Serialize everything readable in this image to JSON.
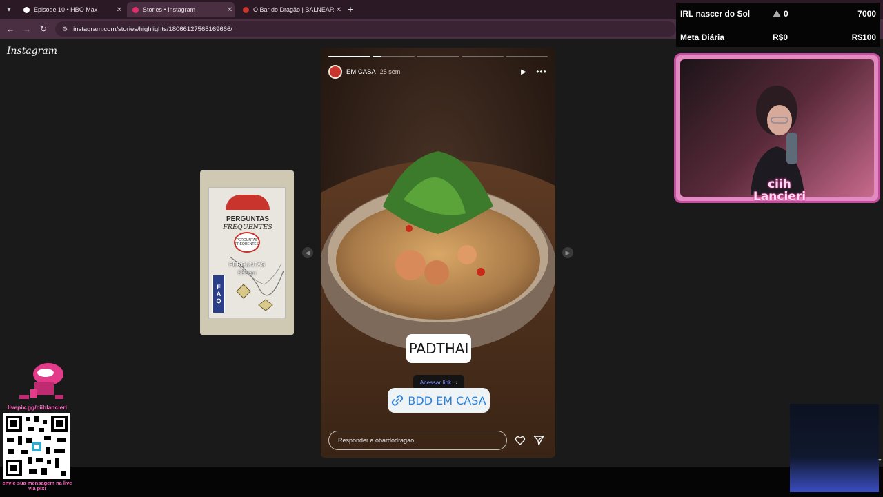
{
  "browser": {
    "tabs": [
      {
        "title": "Episode 10 • HBO Max",
        "active": false,
        "favicon_color": "#ffffff"
      },
      {
        "title": "Stories • Instagram",
        "active": true,
        "favicon_color": "#e1306c"
      },
      {
        "title": "O Bar do Dragão | BALNEARIO",
        "active": false,
        "favicon_color": "#c9342c"
      }
    ],
    "close_glyph": "✕",
    "new_tab_glyph": "+",
    "url": "instagram.com/stories/highlights/18066127565169666/"
  },
  "instagram": {
    "logo": "Instagram",
    "side_story": {
      "name": "PERGUNTAS",
      "time": "58 sem",
      "card_title_1": "PERGUNTAS",
      "card_title_2": "FREQUENTES",
      "badge_text": "PERGUNTAS FREQUENTES",
      "faq_letters": [
        "F",
        "A",
        "Q"
      ]
    },
    "story": {
      "username": "EM CASA",
      "time": "25 sem",
      "progress": [
        1,
        0.2,
        0,
        0,
        0
      ],
      "sticker_text": "PADTHAI",
      "link_tooltip": "Acessar link",
      "link_text": "BDD EM CASA",
      "reply_placeholder": "Responder a obardodragao..."
    }
  },
  "overlay": {
    "goals": [
      {
        "label": "IRL nascer do Sol",
        "current": "0",
        "target": "7000"
      },
      {
        "label": "Meta Diária",
        "current": "R$0",
        "target": "R$100"
      }
    ],
    "streamer_name_line1": "ciih",
    "streamer_name_line2": "Lancieri",
    "pix_url": "livepix.gg/ciihlancieri",
    "pix_message": "envie sua mensagem na live via pix!"
  }
}
